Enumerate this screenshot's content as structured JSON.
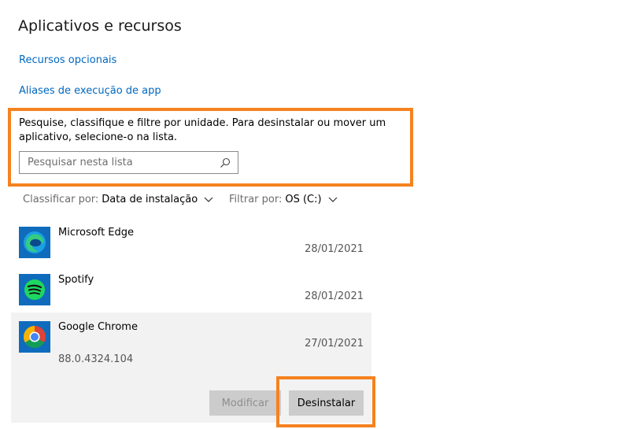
{
  "page": {
    "title": "Aplicativos e recursos",
    "links": {
      "optional_features": "Recursos opcionais",
      "app_execution_aliases": "Aliases de execução de app"
    }
  },
  "search": {
    "description": "Pesquise, classifique e filtre por unidade. Para desinstalar ou mover um aplicativo, selecione-o na lista.",
    "placeholder": "Pesquisar nesta lista",
    "value": ""
  },
  "sort": {
    "label": "Classificar por:",
    "value": "Data de instalação"
  },
  "filter": {
    "label": "Filtrar por:",
    "value": "OS (C:)"
  },
  "apps": [
    {
      "name": "Microsoft Edge",
      "date": "28/01/2021",
      "icon": "microsoft-edge-icon"
    },
    {
      "name": "Spotify",
      "date": "28/01/2021",
      "icon": "spotify-icon"
    },
    {
      "name": "Google Chrome",
      "date": "27/01/2021",
      "version": "88.0.4324.104",
      "icon": "google-chrome-icon",
      "selected": true
    }
  ],
  "buttons": {
    "modify": "Modificar",
    "uninstall": "Desinstalar"
  },
  "colors": {
    "link": "#0067c0",
    "highlight": "#f58220",
    "selected_row": "#f2f2f2",
    "button": "#cccccc"
  }
}
